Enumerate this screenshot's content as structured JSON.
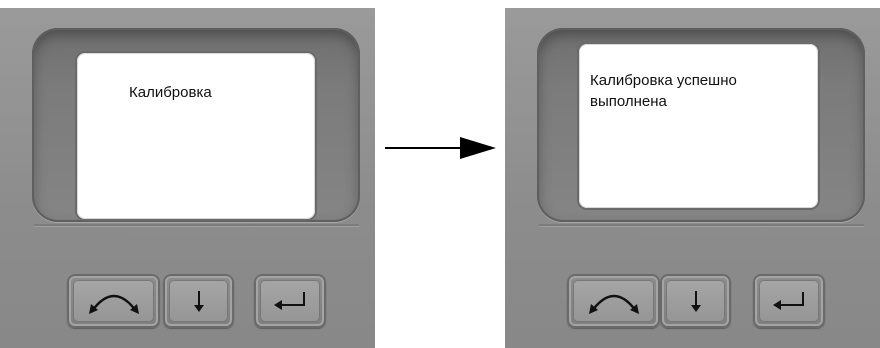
{
  "left_panel": {
    "screen_text": "Калибровка",
    "buttons": [
      {
        "icon": "cycle-arrow-icon"
      },
      {
        "icon": "down-arrow-icon"
      },
      {
        "icon": "enter-arrow-icon"
      }
    ]
  },
  "transition": {
    "icon": "right-arrow-icon"
  },
  "right_panel": {
    "screen_text": "Калибровка успешно выполнена",
    "buttons": [
      {
        "icon": "cycle-arrow-icon"
      },
      {
        "icon": "down-arrow-icon"
      },
      {
        "icon": "enter-arrow-icon"
      }
    ]
  },
  "colors": {
    "device_body": "#8c8c8c",
    "screen": "#ffffff",
    "arrow": "#000000"
  }
}
